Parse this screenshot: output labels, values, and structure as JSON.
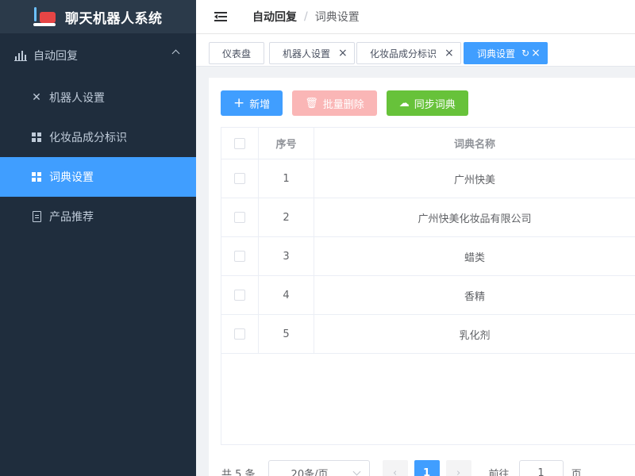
{
  "app": {
    "title": "聊天机器人系统"
  },
  "sidebar": {
    "group": {
      "label": "自动回复",
      "icon": "bar-chart-icon"
    },
    "items": [
      {
        "label": "机器人设置",
        "icon": "tools-icon",
        "active": false
      },
      {
        "label": "化妆品成分标识",
        "icon": "grid-icon",
        "active": false
      },
      {
        "label": "词典设置",
        "icon": "grid-icon",
        "active": true
      },
      {
        "label": "产品推荐",
        "icon": "document-icon",
        "active": false
      }
    ]
  },
  "breadcrumb": {
    "parent": "自动回复",
    "separator": "/",
    "current": "词典设置"
  },
  "tags": [
    {
      "label": "仪表盘",
      "closable": false,
      "active": false
    },
    {
      "label": "机器人设置",
      "closable": true,
      "active": false
    },
    {
      "label": "化妆品成分标识",
      "closable": true,
      "active": false
    },
    {
      "label": "词典设置",
      "closable": true,
      "active": true
    }
  ],
  "toolbar": {
    "add_label": "新增",
    "batch_delete_label": "批量删除",
    "sync_label": "同步词典"
  },
  "table": {
    "headers": {
      "index": "序号",
      "name": "词典名称"
    },
    "rows": [
      {
        "index": "1",
        "name": "广州快美"
      },
      {
        "index": "2",
        "name": "广州快美化妆品有限公司"
      },
      {
        "index": "3",
        "name": "蜡类"
      },
      {
        "index": "4",
        "name": "香精"
      },
      {
        "index": "5",
        "name": "乳化剂"
      }
    ]
  },
  "pagination": {
    "total_text": "共 5 条",
    "page_size": "20条/页",
    "current_page": "1",
    "goto_label": "前往",
    "goto_value": "1",
    "page_unit": "页"
  },
  "colors": {
    "primary": "#409eff",
    "sidebar_bg": "#1f2d3d",
    "danger_light": "#fab6b6",
    "success": "#67c23a"
  }
}
